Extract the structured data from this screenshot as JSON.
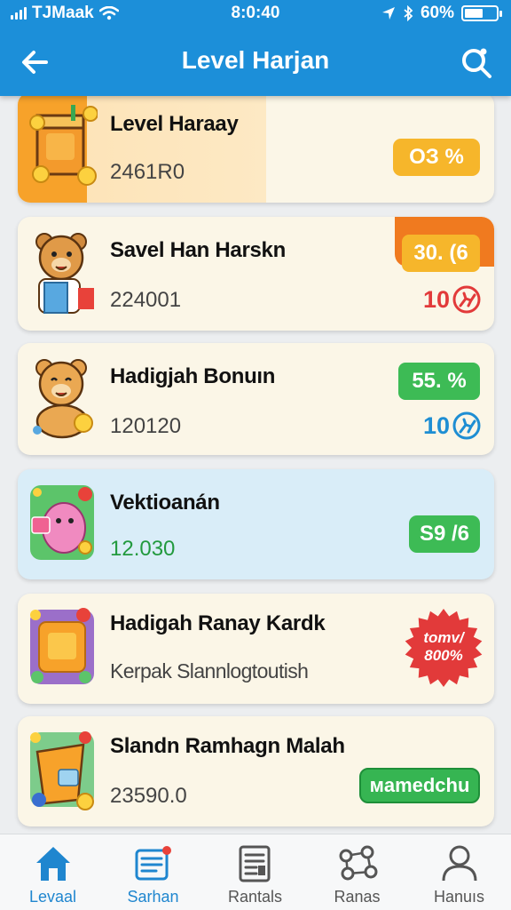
{
  "status_bar": {
    "carrier": "TJMaak",
    "time": "8:0:40",
    "battery": "60%",
    "battery_level": 0.6
  },
  "header": {
    "title": "Level Harjan",
    "back_icon": "arrow-left-icon",
    "search_icon": "search-icon"
  },
  "items": [
    {
      "title": "Level Haraay",
      "value": "2461R0",
      "badge": "ОЗ %",
      "icon": "cup-coins-icon"
    },
    {
      "title": "Savel Han Harskn",
      "value": "224001",
      "badge": "30. (6",
      "bonus": "10",
      "icon": "bear-shopping-icon"
    },
    {
      "title": "Hadigjah Bonuın",
      "value": "120120",
      "badge": "55. %",
      "bonus": "10",
      "icon": "bear-coin-icon"
    },
    {
      "title": "Vektioanán",
      "value": "12.030",
      "badge": "S9 /6",
      "icon": "pink-blob-icon"
    },
    {
      "title": "Hadigah Ranay Kardk",
      "value": "Kerpak Slannlogtoutish",
      "badge": "tomv/ 800%",
      "icon": "gift-box-icon"
    },
    {
      "title": "Slandn Ramhagn Malah",
      "value": "23590.0",
      "badge": "мamedchu",
      "icon": "bucket-coins-icon"
    }
  ],
  "tabs": [
    {
      "label": "Levaal",
      "icon": "home-icon",
      "active": true
    },
    {
      "label": "Sarhan",
      "icon": "list-icon",
      "active": false
    },
    {
      "label": "Rantals",
      "icon": "document-icon",
      "active": false
    },
    {
      "label": "Ranas",
      "icon": "network-icon",
      "active": false
    },
    {
      "label": "Hanuıs",
      "icon": "user-icon",
      "active": false
    }
  ],
  "colors": {
    "header": "#1c8fd9",
    "orange": "#f6b62b",
    "green": "#3dbb55",
    "red": "#e23a3a",
    "blue_accent": "#1e8ed3",
    "active_tab": "#1f86cf"
  }
}
